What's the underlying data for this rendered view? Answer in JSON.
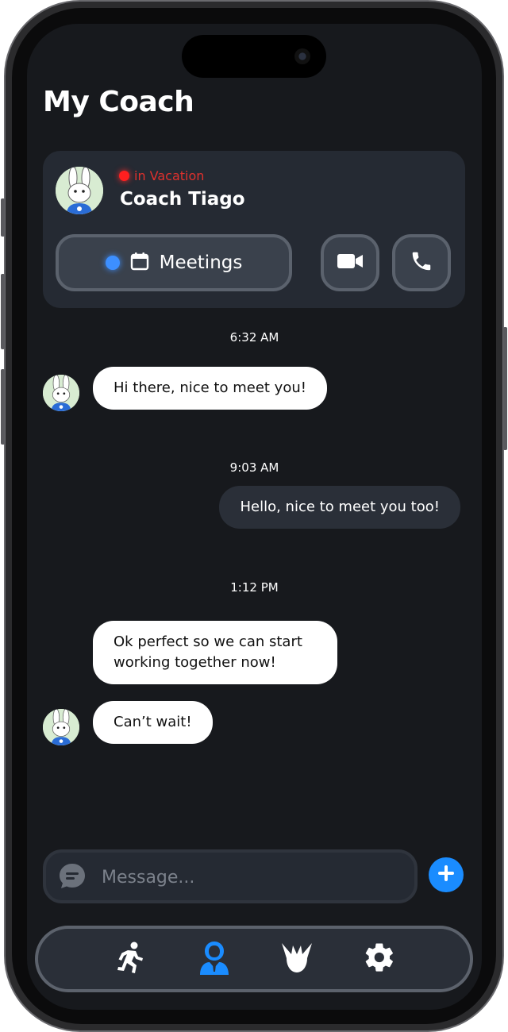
{
  "header": {
    "title": "My Coach"
  },
  "coach": {
    "status": "in Vacation",
    "name": "Coach Tiago",
    "meetings_label": "Meetings",
    "status_color": "#e0312d",
    "accent": "#3d8fff"
  },
  "messages": [
    {
      "time": "6:32 AM",
      "text": "Hi there, nice to meet you!",
      "from": "coach"
    },
    {
      "time": "9:03 AM",
      "text": "Hello, nice to meet you too!",
      "from": "me"
    },
    {
      "time": "1:12 PM",
      "text": "Ok perfect so we can start working together now!",
      "from": "coach"
    },
    {
      "text": "Can’t wait!",
      "from": "coach"
    }
  ],
  "composer": {
    "placeholder": "Message..."
  },
  "tabs": [
    {
      "icon": "running-icon",
      "active": false
    },
    {
      "icon": "coach-icon",
      "active": true
    },
    {
      "icon": "rabbit-logo-icon",
      "active": false
    },
    {
      "icon": "gear-icon",
      "active": false
    }
  ]
}
